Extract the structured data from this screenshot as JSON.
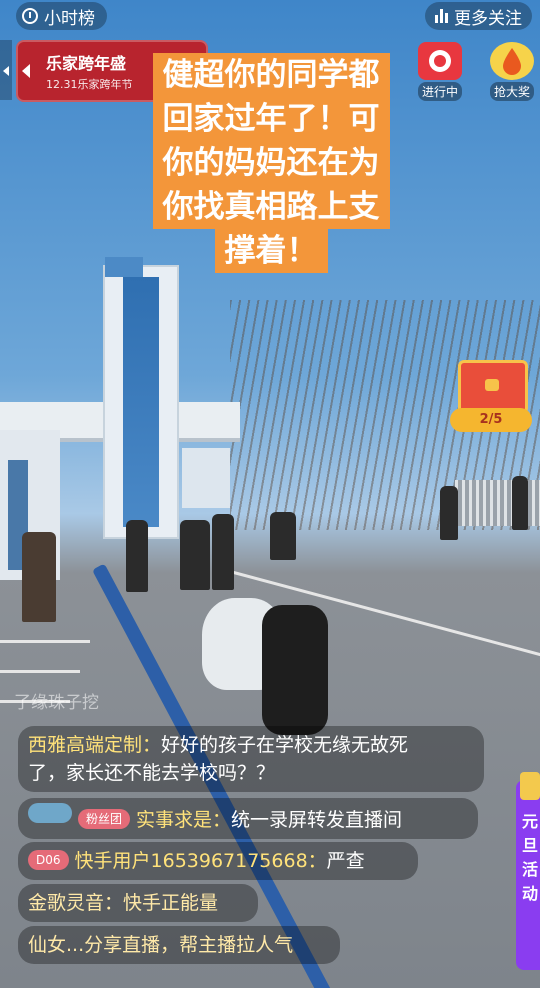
{
  "topbar": {
    "hour_rank": "小时榜",
    "more_follow": "更多关注"
  },
  "banner": {
    "title": "乐家跨年盛",
    "subtitle": "12.31乐家跨年节"
  },
  "events": [
    {
      "label": "进行中",
      "icon": "gift-event-icon",
      "color": "#e8373f"
    },
    {
      "label": "抢大奖",
      "icon": "prize-drop-icon",
      "color": "#f2a324"
    }
  ],
  "caption": {
    "lines": [
      "健超你的同学都",
      "回家过年了！可",
      "你的妈妈还在为",
      "你找真相路上支",
      "撑着！"
    ],
    "background_color": "#f3963a"
  },
  "chest": {
    "progress": "2/5"
  },
  "comments": {
    "faded": "了缘珠子挖"
  },
  "comment_list": [
    {
      "user": "西雅高端定制：",
      "text": "好好的孩子在学校无缘无故死",
      "text2": "了，家长还不能去学校吗？？"
    },
    {
      "badge": "粉丝团",
      "user": "实事求是：",
      "text": "统一录屏转发直播间"
    },
    {
      "badge": "D06",
      "user": "快手用户1653967175668：",
      "text": "严查"
    },
    {
      "user": "金歌灵音：",
      "text": "快手正能量"
    },
    {
      "user": "仙女...分享直播，",
      "text": "帮主播拉人气"
    }
  ],
  "side_card": {
    "text": "元旦活动"
  }
}
